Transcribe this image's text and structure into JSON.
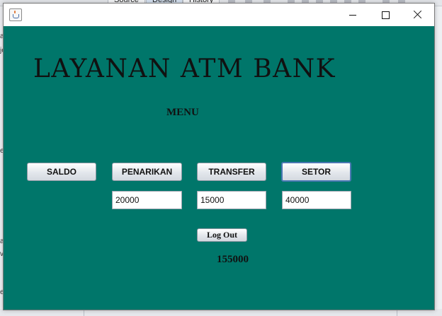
{
  "ide": {
    "tabs": [
      "Source",
      "Design",
      "History"
    ],
    "left_letters": [
      "a",
      "je",
      "e",
      "a",
      "v",
      "e"
    ]
  },
  "window": {
    "title": "",
    "icon": "java-icon",
    "controls": [
      "minimize-icon",
      "maximize-icon",
      "close-icon"
    ]
  },
  "app": {
    "heading": "LAYANAN ATM BANK",
    "menu_label": "MENU",
    "buttons": {
      "saldo": "SALDO",
      "penarikan": "PENARIKAN",
      "transfer": "TRANSFER",
      "setor": "SETOR"
    },
    "fields": {
      "penarikan": "20000",
      "transfer": "15000",
      "setor": "40000"
    },
    "logout_label": "Log Out",
    "balance": "155000"
  },
  "colors": {
    "panel_background": "#00766a",
    "focused_button_border": "#4a78b3"
  }
}
